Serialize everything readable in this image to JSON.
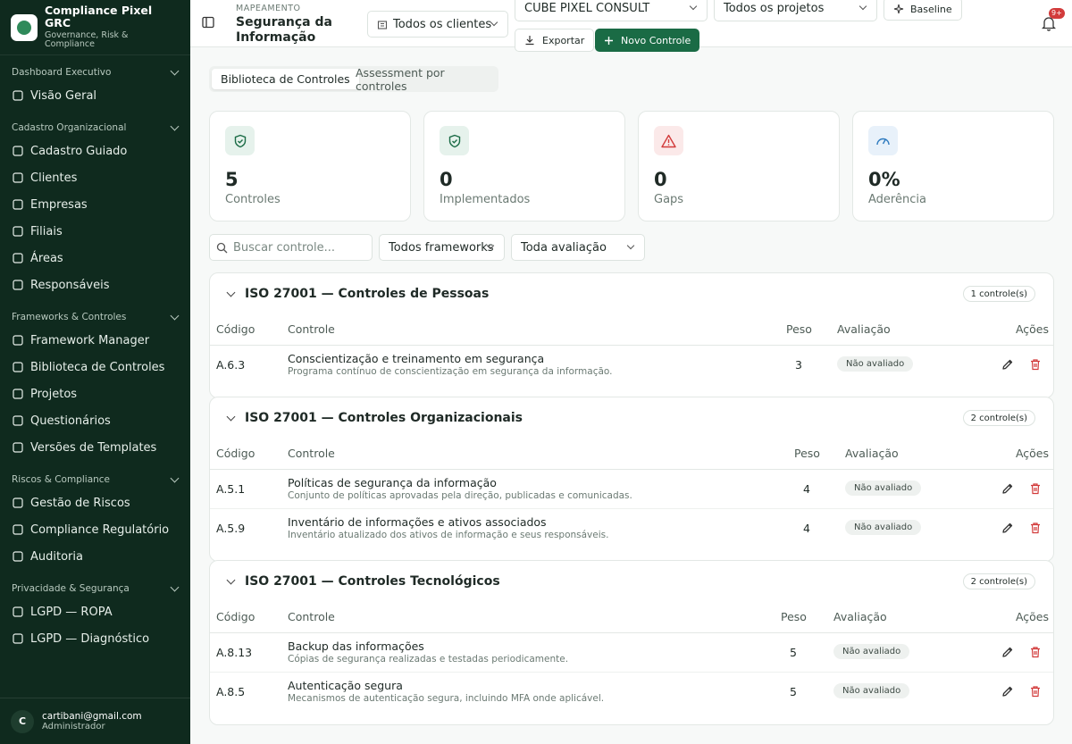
{
  "brand": {
    "title": "Compliance Pixel GRC",
    "subtitle": "Governance, Risk & Compliance"
  },
  "sidebar": {
    "groups": [
      {
        "title": "Dashboard Executivo",
        "items": [
          {
            "label": "Visão Geral",
            "icon": "grid-icon"
          }
        ]
      },
      {
        "title": "Cadastro Organizacional",
        "items": [
          {
            "label": "Cadastro Guiado",
            "icon": "route-icon"
          },
          {
            "label": "Clientes",
            "icon": "building-icon"
          },
          {
            "label": "Empresas",
            "icon": "building-2-icon"
          },
          {
            "label": "Filiais",
            "icon": "office-icon"
          },
          {
            "label": "Áreas",
            "icon": "network-icon"
          },
          {
            "label": "Responsáveis",
            "icon": "users-icon"
          }
        ]
      },
      {
        "title": "Frameworks & Controles",
        "items": [
          {
            "label": "Framework Manager",
            "icon": "layers-icon"
          },
          {
            "label": "Biblioteca de Controles",
            "icon": "library-icon"
          },
          {
            "label": "Projetos",
            "icon": "clipboard-icon"
          },
          {
            "label": "Questionários",
            "icon": "list-checks-icon"
          },
          {
            "label": "Versões de Templates",
            "icon": "git-branch-icon"
          }
        ]
      },
      {
        "title": "Riscos & Compliance",
        "items": [
          {
            "label": "Gestão de Riscos",
            "icon": "alert-icon"
          },
          {
            "label": "Compliance Regulatório",
            "icon": "scale-icon"
          },
          {
            "label": "Auditoria",
            "icon": "history-icon"
          }
        ]
      },
      {
        "title": "Privacidade & Segurança",
        "items": [
          {
            "label": "LGPD — ROPA",
            "icon": "file-icon"
          },
          {
            "label": "LGPD — Diagnóstico",
            "icon": "file-search-icon"
          }
        ]
      }
    ]
  },
  "user": {
    "initial": "C",
    "email": "cartibani@gmail.com",
    "role": "Administrador"
  },
  "header": {
    "eyebrow": "MAPEAMENTO",
    "title": "Segurança da Informação",
    "client_select": "Todos os clientes",
    "company_select": "CUBE PIXEL CONSULT",
    "project_select": "Todos os projetos",
    "baseline_label": "Baseline",
    "export_label": "Exportar",
    "new_label": "Novo Controle",
    "notif_badge": "9+"
  },
  "tabs": [
    {
      "label": "Biblioteca de Controles",
      "active": true
    },
    {
      "label": "Assessment por controles",
      "active": false
    }
  ],
  "stats": [
    {
      "value": "5",
      "label": "Controles",
      "color": "#1a6b45",
      "bg": "#e6f2ec",
      "icon": "shield-check-icon"
    },
    {
      "value": "0",
      "label": "Implementados",
      "color": "#1a6b45",
      "bg": "#e6f2ec",
      "icon": "shield-check-icon"
    },
    {
      "value": "0",
      "label": "Gaps",
      "color": "#d23b3b",
      "bg": "#fbe9e9",
      "icon": "warning-icon"
    },
    {
      "value": "0%",
      "label": "Aderência",
      "color": "#2f7bbf",
      "bg": "#e8f1fa",
      "icon": "gauge-icon"
    }
  ],
  "filters": {
    "search_placeholder": "Buscar controle...",
    "framework": "Todos frameworks",
    "evaluation": "Toda avaliação"
  },
  "table_headers": {
    "code": "Código",
    "control": "Controle",
    "weight": "Peso",
    "evaluation": "Avaliação",
    "actions": "Ações"
  },
  "sections": [
    {
      "title": "ISO 27001 — Controles de Pessoas",
      "count": "1 controle(s)",
      "rows": [
        {
          "code": "A.6.3",
          "name": "Conscientização e treinamento em segurança",
          "desc": "Programa contínuo de conscientização em segurança da informação.",
          "weight": "3",
          "status": "Não avaliado"
        }
      ]
    },
    {
      "title": "ISO 27001 — Controles Organizacionais",
      "count": "2 controle(s)",
      "rows": [
        {
          "code": "A.5.1",
          "name": "Políticas de segurança da informação",
          "desc": "Conjunto de políticas aprovadas pela direção, publicadas e comunicadas.",
          "weight": "4",
          "status": "Não avaliado"
        },
        {
          "code": "A.5.9",
          "name": "Inventário de informações e ativos associados",
          "desc": "Inventário atualizado dos ativos de informação e seus responsáveis.",
          "weight": "4",
          "status": "Não avaliado"
        }
      ]
    },
    {
      "title": "ISO 27001 — Controles Tecnológicos",
      "count": "2 controle(s)",
      "rows": [
        {
          "code": "A.8.13",
          "name": "Backup das informações",
          "desc": "Cópias de segurança realizadas e testadas periodicamente.",
          "weight": "5",
          "status": "Não avaliado"
        },
        {
          "code": "A.8.5",
          "name": "Autenticação segura",
          "desc": "Mecanismos de autenticação segura, incluindo MFA onde aplicável.",
          "weight": "5",
          "status": "Não avaliado"
        }
      ]
    }
  ]
}
